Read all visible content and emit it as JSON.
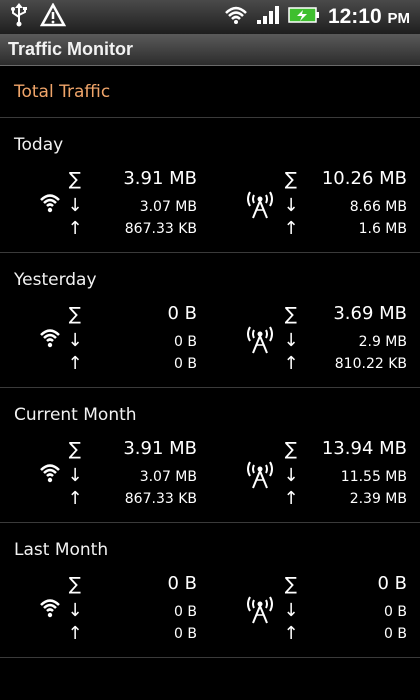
{
  "status_bar": {
    "time": "12:10",
    "ampm": "PM",
    "icons": [
      "usb-icon",
      "warning-icon",
      "wifi-icon",
      "signal-icon",
      "battery-charging-icon"
    ]
  },
  "app": {
    "title": "Traffic Monitor"
  },
  "header": {
    "label": "Total Traffic",
    "color": "#f0a56a"
  },
  "symbols": {
    "total": "∑",
    "down": "↓",
    "up": "↑"
  },
  "sections": [
    {
      "title": "Today",
      "wifi": {
        "total": "3.91 MB",
        "down": "3.07 MB",
        "up": "867.33 KB"
      },
      "mobile": {
        "total": "10.26 MB",
        "down": "8.66 MB",
        "up": "1.6 MB"
      }
    },
    {
      "title": "Yesterday",
      "wifi": {
        "total": "0 B",
        "down": "0 B",
        "up": "0 B"
      },
      "mobile": {
        "total": "3.69 MB",
        "down": "2.9 MB",
        "up": "810.22 KB"
      }
    },
    {
      "title": "Current Month",
      "wifi": {
        "total": "3.91 MB",
        "down": "3.07 MB",
        "up": "867.33 KB"
      },
      "mobile": {
        "total": "13.94 MB",
        "down": "11.55 MB",
        "up": "2.39 MB"
      }
    },
    {
      "title": "Last Month",
      "wifi": {
        "total": "0 B",
        "down": "0 B",
        "up": "0 B"
      },
      "mobile": {
        "total": "0 B",
        "down": "0 B",
        "up": "0 B"
      }
    }
  ]
}
